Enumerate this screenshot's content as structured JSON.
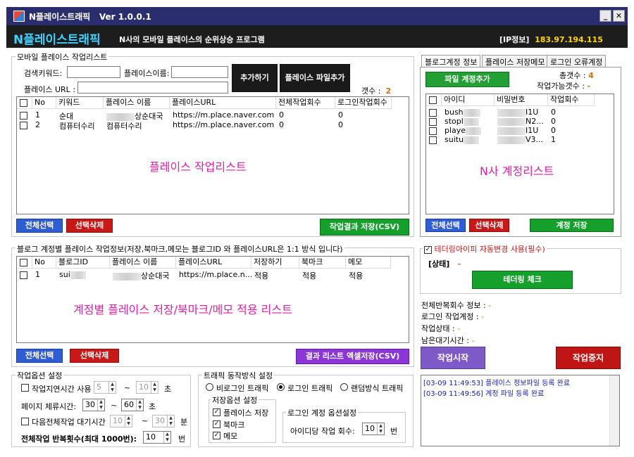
{
  "window": {
    "title": "N플레이스트래픽",
    "version": "Ver 1.0.0.1",
    "minimize": "_",
    "close": "✕"
  },
  "header": {
    "app_name": "N플레이스트래픽",
    "subtitle": "N사의 모바일 플레이스의 순위상승 프로그램",
    "ip_label": "[IP정보]",
    "ip_value": "183.97.194.115"
  },
  "place_list": {
    "group_label": "모바일 플레이스 작업리스트",
    "search_keyword_label": "검색키워드:",
    "place_name_label": "플레이스이름:",
    "place_url_label": "플레이스 URL :",
    "search_keyword_value": "",
    "place_name_value": "",
    "place_url_value": "",
    "add_button": "추가하기",
    "add_file_button": "플레이스 파일추가",
    "count_label": "갯수 :",
    "count_value": "2",
    "columns": [
      "No",
      "키워드",
      "플레이스 이름",
      "플레이스URL",
      "전체작업회수",
      "로그인작업회수"
    ],
    "rows": [
      {
        "no": "1",
        "keyword": "순대",
        "name": "상순대국",
        "url": "https://m.place.naver.com,...",
        "total": "0",
        "login": "0"
      },
      {
        "no": "2",
        "keyword": "컴퓨터수리",
        "name": "컴퓨터수리",
        "url": "https://m.place.naver.com,...",
        "total": "0",
        "login": "0"
      }
    ],
    "watermark": "플레이스 작업리스트",
    "select_all": "전체선택",
    "delete_selected": "선택삭제",
    "save_csv": "작업결과 저장(CSV)"
  },
  "account_place_list": {
    "group_label": "블로그 계정별 플레이스 작업정보(저장,북마크,메모는 블로그ID 와 플레이스URL은 1:1 방식 입니다)",
    "columns": [
      "No",
      "블로그ID",
      "플레이스 이름",
      "플레이스URL",
      "저장하기",
      "북마크",
      "메모"
    ],
    "rows": [
      {
        "no": "1",
        "id": "sui",
        "name": "상순대국",
        "url": "https://m.place.n...",
        "save": "적용",
        "bookmark": "적용",
        "memo": "적용"
      }
    ],
    "watermark": "계정별 플레이스 저장/북마크/메모 적용 리스트",
    "select_all": "전체선택",
    "delete_selected": "선택삭제",
    "save_excel": "결과 리스트 엑셀저장(CSV)"
  },
  "tabs": [
    "블로그계정 정보",
    "플레이스 저장메모",
    "로그인 오류계정"
  ],
  "accounts": {
    "add_file_button": "파일 계정추가",
    "total_label": "총갯수 :",
    "total_value": "4",
    "available_label": "작업가능갯수 :",
    "available_value": "-",
    "columns": [
      "아이디",
      "비밀번호",
      "작업회수"
    ],
    "rows": [
      {
        "id": "bush",
        "pw": "I1U",
        "count": "0"
      },
      {
        "id": "stopl",
        "pw": "N2...",
        "count": "0"
      },
      {
        "id": "playe",
        "pw": "I1U",
        "count": "0"
      },
      {
        "id": "suitu",
        "pw": "V3...",
        "count": "1"
      }
    ],
    "watermark": "N사 계정리스트",
    "select_all": "전체선택",
    "delete_selected": "선택삭제",
    "save_accounts": "계정 저장"
  },
  "tethering": {
    "checkbox_label": "테더링아이피 자동변경 사용(필수)",
    "status_label": "[상태]",
    "status_value": "-",
    "check_button": "테더링 체크"
  },
  "status": {
    "repeat_label": "전체반복회수 정보 :",
    "repeat_value": "-",
    "login_label": "로그인 작업계정 :",
    "login_value": "-",
    "state_label": "작업상태 :",
    "state_value": "-",
    "wait_label": "남은대기시간 :",
    "wait_value": "-"
  },
  "controls": {
    "start": "작업시작",
    "stop": "작업중지"
  },
  "log": [
    "[03-09 11:49:53] 플레이스 정보파일 등록 완료",
    "[03-09 11:49:56] 계정 파일 등록 완료"
  ],
  "work_options": {
    "group_label": "작업옵션 설정",
    "delay_label": "작업지연시간 사용",
    "delay_from": "5",
    "delay_to": "10",
    "sec": "초",
    "tilde": "~",
    "stay_label": "페이지 체류시간:",
    "stay_from": "30",
    "stay_to": "60",
    "next_wait_label": "다음전체작업 대기시간",
    "next_from": "10",
    "next_to": "30",
    "minute": "분",
    "repeat_label": "전체작업 반복횟수(최대 1000번):",
    "repeat_value": "10",
    "times": "번"
  },
  "traffic": {
    "group_label": "트래픽 동작방식 설정",
    "radio_nonlogin": "비로그인 트래픽",
    "radio_login": "로그인 트래픽",
    "radio_random": "랜덤방식 트래픽",
    "storage_group": "저장옵션 설정",
    "opt_save": "플레이스 저장",
    "opt_bookmark": "북마크",
    "opt_memo": "메모",
    "login_group": "로그인 계정 옵션설정",
    "per_id_label": "아이디당 작업 회수:",
    "per_id_value": "10",
    "times": "번"
  }
}
